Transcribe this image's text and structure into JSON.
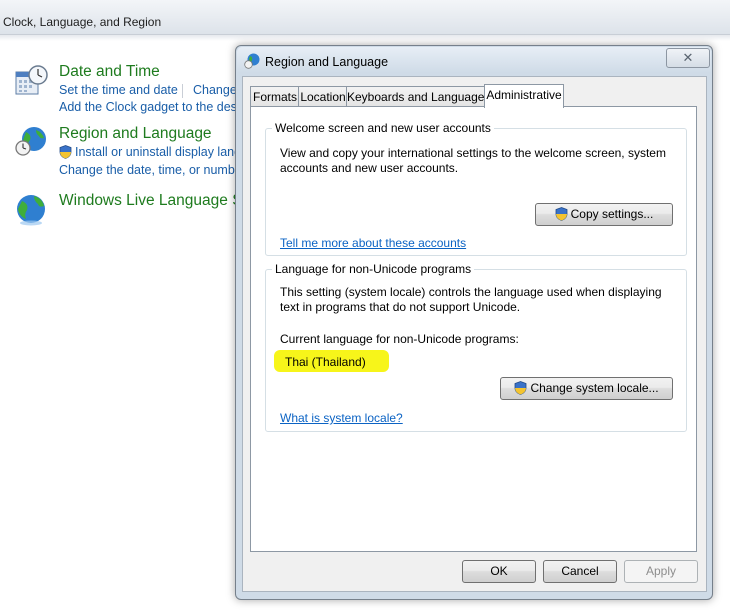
{
  "control_panel": {
    "breadcrumb": "Clock, Language, and Region",
    "date_time": {
      "title": "Date and Time",
      "links": [
        "Set the time and date",
        "Change",
        "Add the Clock gadget to the desk"
      ]
    },
    "region_language": {
      "title": "Region and Language",
      "links": [
        "Install or uninstall display lang",
        "Change the date, time, or numbe"
      ]
    },
    "live_language": {
      "title": "Windows Live Language S"
    }
  },
  "dialog": {
    "title": "Region and Language",
    "close_glyph": "✕",
    "tabs": [
      {
        "label": "Formats"
      },
      {
        "label": "Location"
      },
      {
        "label": "Keyboards and Languages"
      },
      {
        "label": "Administrative"
      }
    ],
    "active_tab": "Administrative",
    "welcome_group": {
      "legend": "Welcome screen and new user accounts",
      "description_line1": "View and copy your international settings to the welcome screen, system",
      "description_line2": "accounts and new user accounts.",
      "copy_button": "Copy settings...",
      "link": "Tell me more about these accounts"
    },
    "nonunicode_group": {
      "legend": "Language for non-Unicode programs",
      "description_line1": "This setting (system locale) controls the language used when displaying",
      "description_line2": "text in programs that do not support Unicode.",
      "current_label": "Current language for non-Unicode programs:",
      "current_value": "Thai (Thailand)",
      "change_button": "Change system locale...",
      "link": "What is system locale?"
    },
    "buttons": {
      "ok": "OK",
      "cancel": "Cancel",
      "apply": "Apply"
    }
  },
  "colors": {
    "category_title": "#1e7b1e",
    "link": "#1a5ea8",
    "dialog_link": "#0b63c4",
    "highlight": "#f7f51a"
  }
}
